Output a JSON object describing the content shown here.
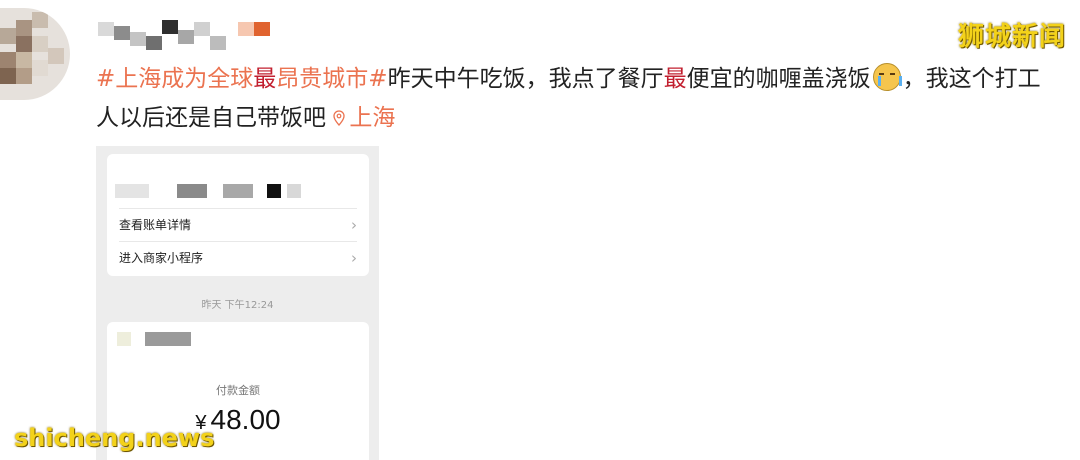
{
  "watermark_top": "狮城新闻",
  "watermark_bottom": "shicheng.news",
  "post": {
    "hash_open": "#",
    "tag_text_a": "上海成为全球",
    "tag_text_red": "最",
    "tag_text_b": "昂贵城市",
    "hash_close": "#",
    "text_a": "昨天中午吃饭，我点了餐厅",
    "text_red": "最",
    "text_b": "便宜的咖喱盖浇饭",
    "text_c": "，我这个打工人以后还是自己带饭吧",
    "location": "上海",
    "emoji": "crying-face"
  },
  "screenshot": {
    "menu": [
      {
        "label": "查看账单详情"
      },
      {
        "label": "进入商家小程序"
      }
    ],
    "timestamp": "昨天 下午12:24",
    "payment_label": "付款金额",
    "currency_symbol": "¥",
    "amount": "48.00"
  },
  "colors": {
    "topic": "#eb7350",
    "highlight": "#c21f2f",
    "watermark": "#f3d21a"
  }
}
